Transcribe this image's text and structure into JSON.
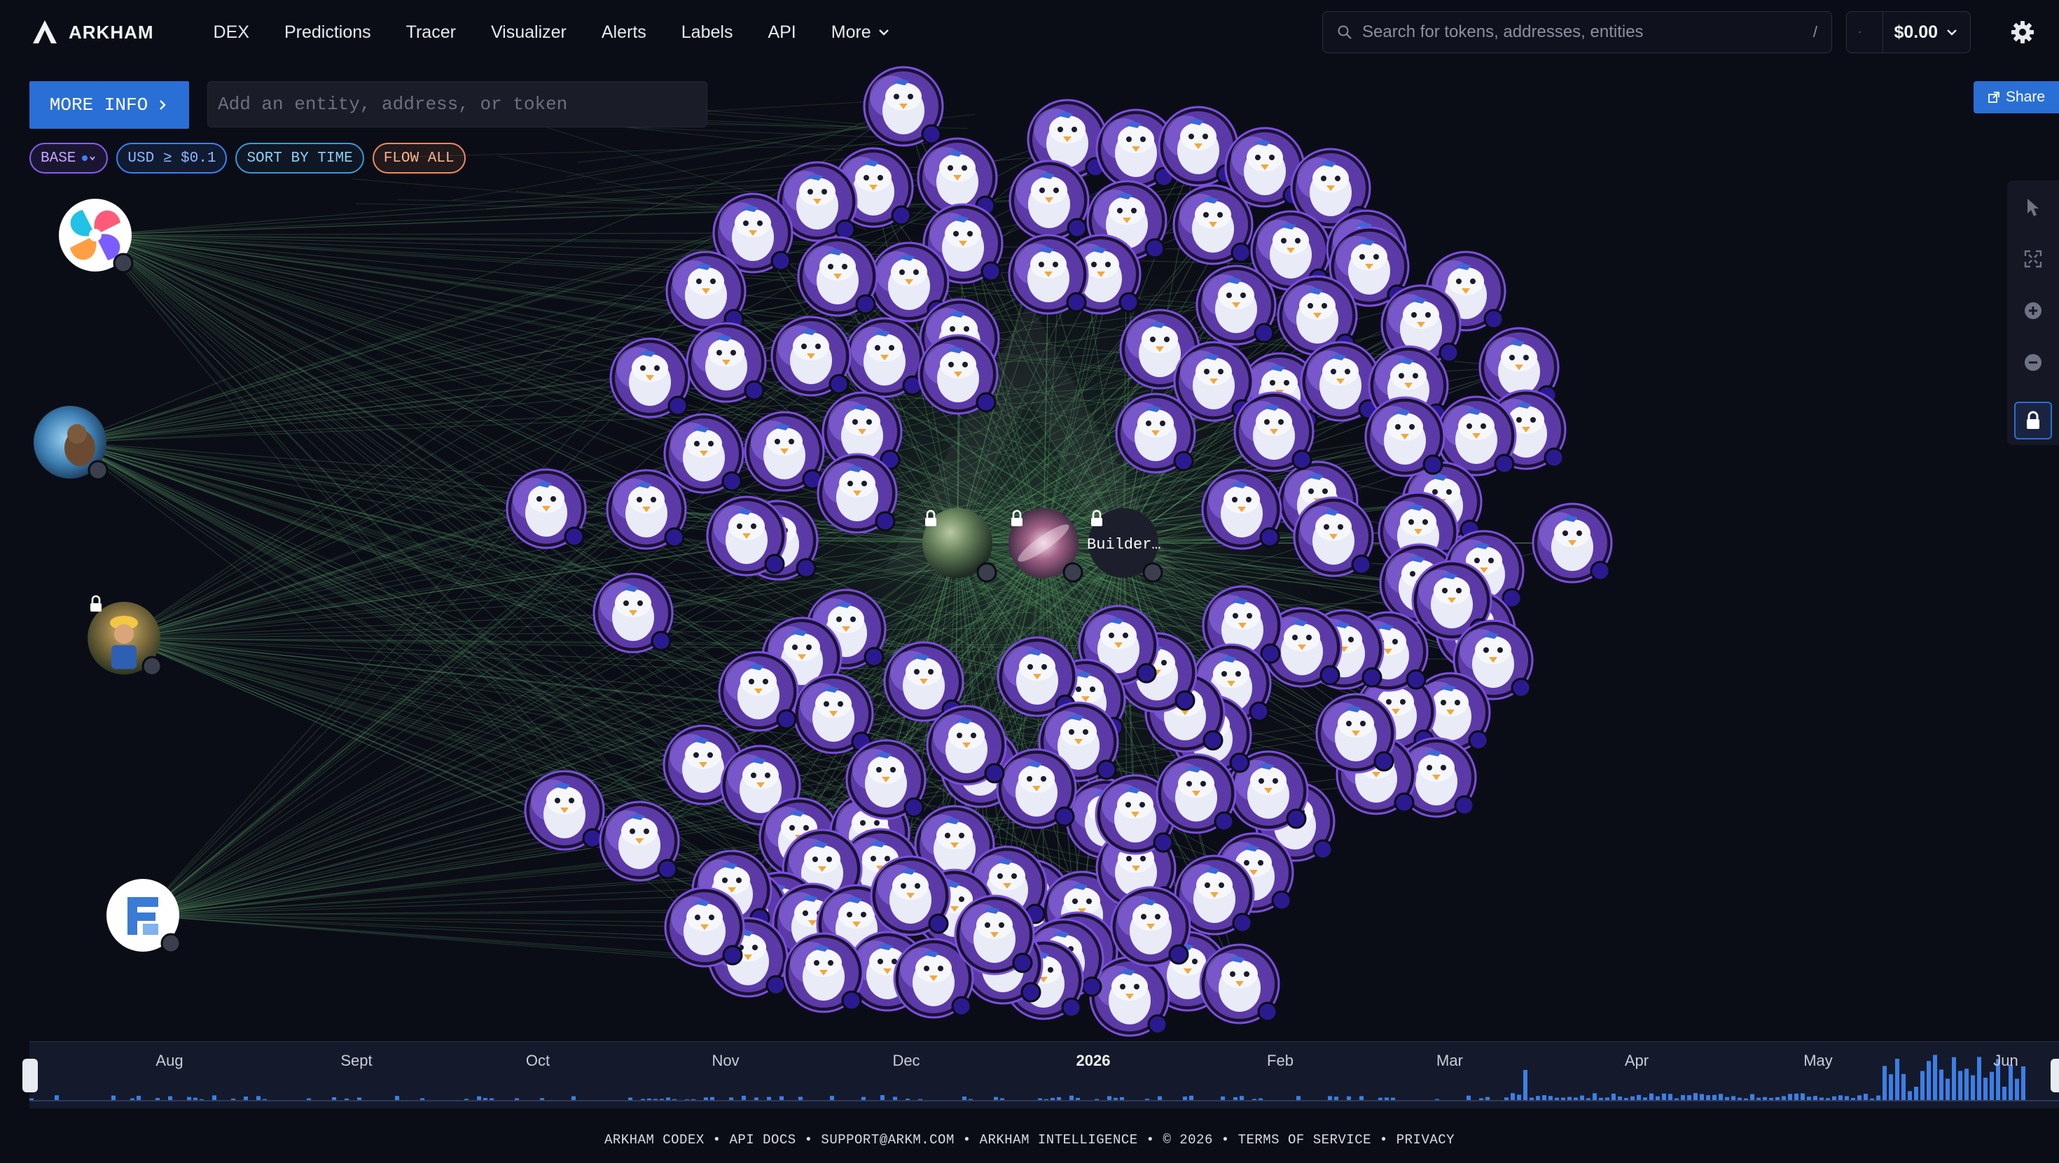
{
  "brand": {
    "name": "ARKHAM"
  },
  "nav": {
    "items": [
      {
        "label": "DEX"
      },
      {
        "label": "Predictions"
      },
      {
        "label": "Tracer"
      },
      {
        "label": "Visualizer"
      },
      {
        "label": "Alerts"
      },
      {
        "label": "Labels"
      },
      {
        "label": "API"
      },
      {
        "label": "More"
      }
    ]
  },
  "search": {
    "placeholder": "Search for tokens, addresses, entities",
    "shortcut": "/"
  },
  "wallet": {
    "balance": "$0.00"
  },
  "controls": {
    "more_info_label": "MORE INFO",
    "entity_input_placeholder": "Add an entity, address, or token",
    "share_label": "Share"
  },
  "filters": {
    "chain": "BASE",
    "usd": "USD ≥ $0.1",
    "sort": "SORT BY TIME",
    "flow": "FLOW ALL"
  },
  "graph": {
    "center_node_label": "Builder…",
    "colors": {
      "edge": "#5fa36b",
      "node_ring": "#7b4fe0",
      "badge": "#2b1a8f",
      "accent": "#2a6fd6"
    }
  },
  "timeline": {
    "months": [
      "Aug",
      "Sept",
      "Oct",
      "Nov",
      "Dec",
      "2026",
      "Feb",
      "Mar",
      "Apr",
      "May",
      "Jun"
    ],
    "bar_color": "#3b7fe6"
  },
  "footer": {
    "items": [
      "ARKHAM CODEX",
      "API DOCS",
      "SUPPORT@ARKM.COM",
      "ARKHAM INTELLIGENCE",
      "© 2026",
      "TERMS OF SERVICE",
      "PRIVACY"
    ]
  }
}
